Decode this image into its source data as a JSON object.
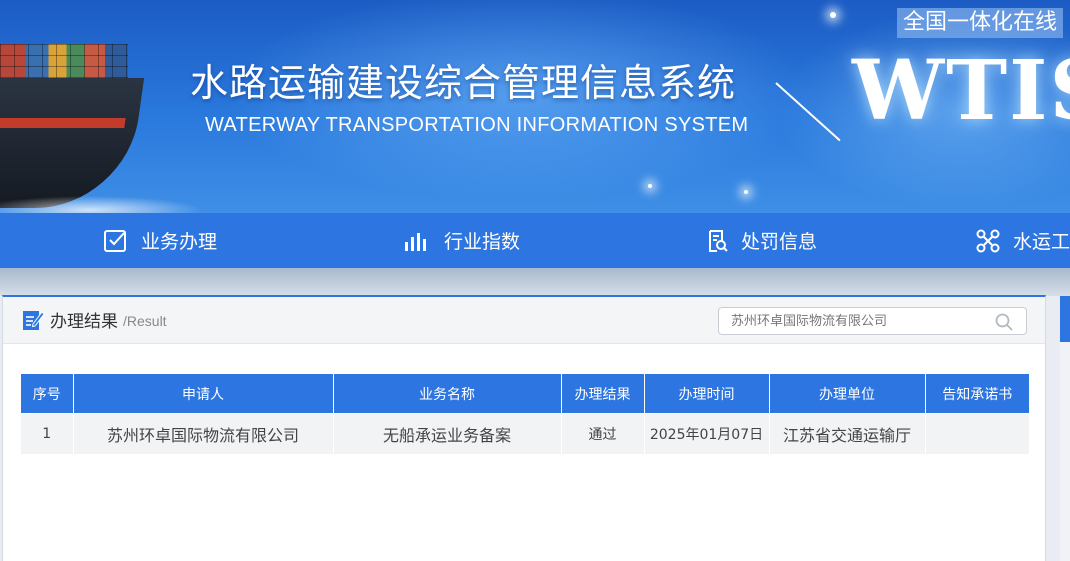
{
  "header": {
    "title_cn": "水路运输建设综合管理信息系统",
    "title_en": "WATERWAY TRANSPORTATION INFORMATION SYSTEM",
    "logo": "WTIS",
    "top_link": "全国一体化在线"
  },
  "nav": {
    "items": [
      {
        "label": "业务办理",
        "icon": "checklist-icon"
      },
      {
        "label": "行业指数",
        "icon": "bar-chart-icon"
      },
      {
        "label": "处罚信息",
        "icon": "document-search-icon"
      },
      {
        "label": "水运工",
        "icon": "network-icon"
      }
    ]
  },
  "panel": {
    "title_cn": "办理结果",
    "title_en": "/Result",
    "search": {
      "value": "",
      "placeholder": "苏州环卓国际物流有限公司"
    }
  },
  "table": {
    "columns": [
      "序号",
      "申请人",
      "业务名称",
      "办理结果",
      "办理时间",
      "办理单位",
      "告知承诺书"
    ],
    "rows": [
      {
        "index": "1",
        "applicant": "苏州环卓国际物流有限公司",
        "business": "无船承运业务备案",
        "result": "通过",
        "time": "2025年01月07日",
        "unit": "江苏省交通运输厅",
        "pledge": ""
      }
    ]
  },
  "colors": {
    "primary_blue": "#2d76e2",
    "banner_blue": "#1c5cc4",
    "row_bg": "#f2f3f5"
  }
}
